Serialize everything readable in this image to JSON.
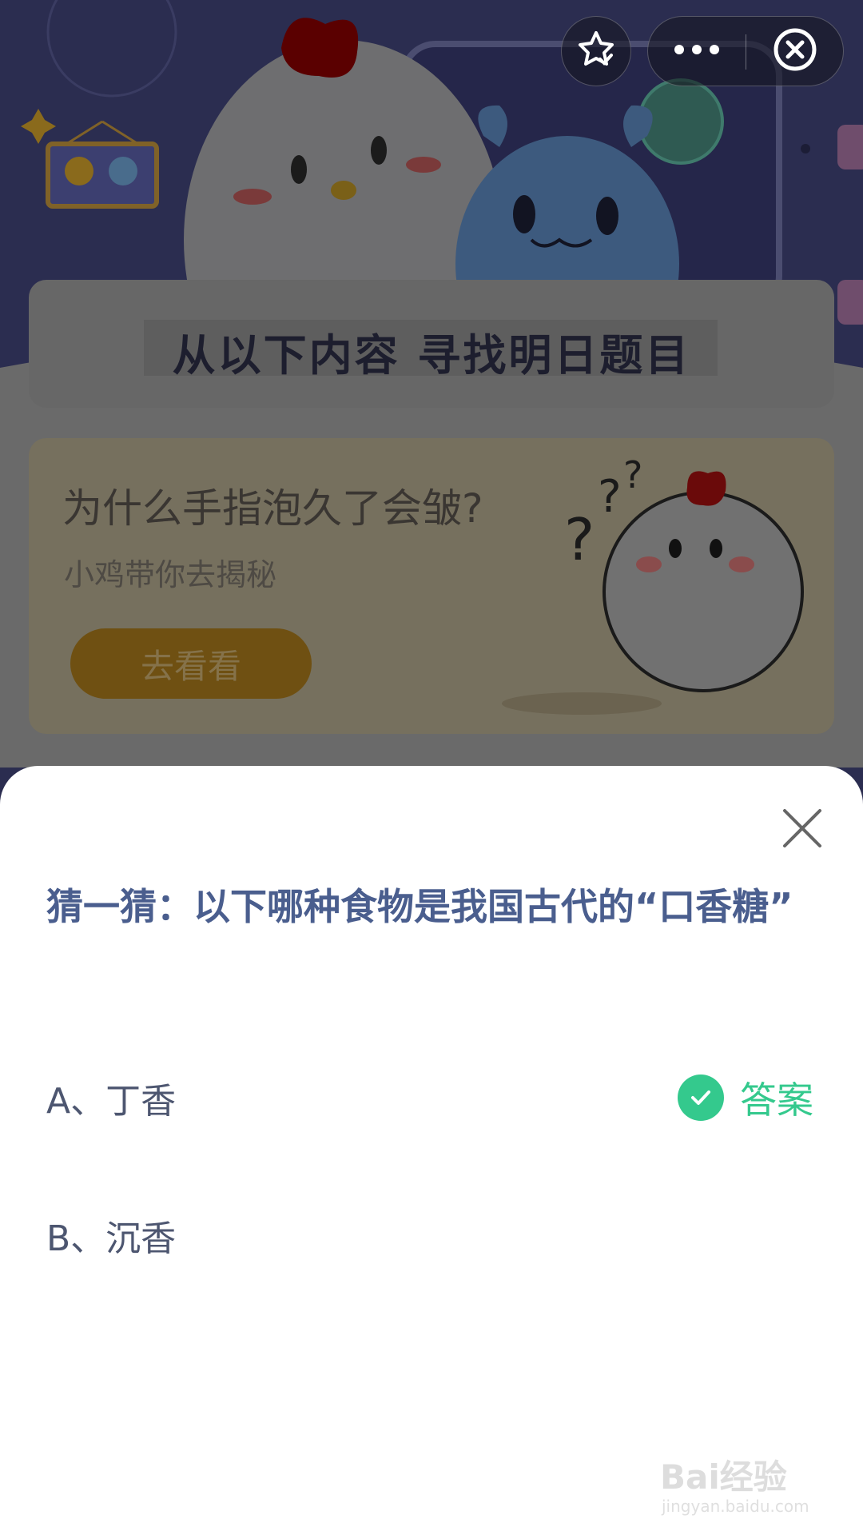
{
  "top_controls": {
    "favorite_icon": "star-check-icon",
    "more_icon": "more-dots-icon",
    "close_icon": "close-circle-icon"
  },
  "banner": {
    "title": "从以下内容  寻找明日题目"
  },
  "promo": {
    "title": "为什么手指泡久了会皱?",
    "subtitle": "小鸡带你去揭秘",
    "button_label": "去看看"
  },
  "sheet": {
    "question": "猜一猜：以下哪种食物是我国古代的“口香糖”",
    "options": [
      {
        "label": "A、丁香",
        "is_answer": true
      },
      {
        "label": "B、沉香",
        "is_answer": false
      }
    ],
    "answer_label": "答案"
  },
  "watermark": {
    "main": "Bai经验",
    "url": "jingyan.baidu.com"
  },
  "colors": {
    "question": "#4a5e8e",
    "answer": "#34c98d",
    "sheet_bg": "#ffffff"
  }
}
